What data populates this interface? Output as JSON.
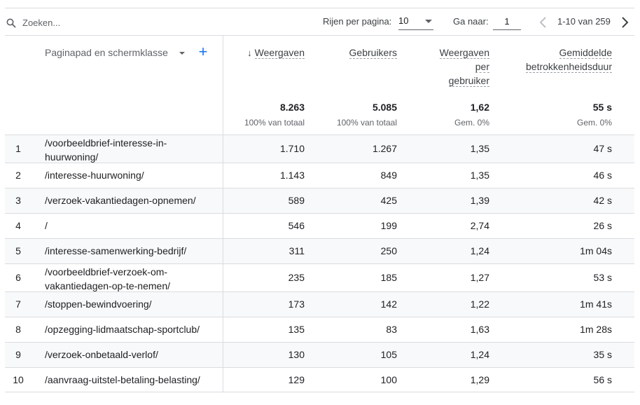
{
  "toolbar": {
    "search_placeholder": "Zoeken...",
    "rows_per_page_label": "Rijen per pagina:",
    "rows_per_page_value": "10",
    "goto_label": "Ga naar:",
    "goto_value": "1",
    "range_text": "1-10 van 259"
  },
  "header": {
    "dimension_label": "Paginapad en schermklasse",
    "columns": [
      {
        "label_lines": [
          "Weergaven"
        ],
        "total": "8.263",
        "total_sub": "100% van totaal",
        "sorted": true
      },
      {
        "label_lines": [
          "Gebruikers"
        ],
        "total": "5.085",
        "total_sub": "100% van totaal",
        "sorted": false
      },
      {
        "label_lines": [
          "Weergaven",
          "per",
          "gebruiker"
        ],
        "total": "1,62",
        "total_sub": "Gem. 0%",
        "sorted": false
      },
      {
        "label_lines": [
          "Gemiddelde",
          "betrokkenheidsduur"
        ],
        "total": "55 s",
        "total_sub": "Gem. 0%",
        "sorted": false
      }
    ]
  },
  "rows": [
    {
      "index": "1",
      "path_lines": [
        "/voorbeeldbrief-interesse-in-",
        "huurwoning/"
      ],
      "views": "1.710",
      "users": "1.267",
      "views_per_user": "1,35",
      "duration": "47 s"
    },
    {
      "index": "2",
      "path_lines": [
        "/interesse-huurwoning/"
      ],
      "views": "1.143",
      "users": "849",
      "views_per_user": "1,35",
      "duration": "46 s"
    },
    {
      "index": "3",
      "path_lines": [
        "/verzoek-vakantiedagen-opnemen/"
      ],
      "views": "589",
      "users": "425",
      "views_per_user": "1,39",
      "duration": "42 s"
    },
    {
      "index": "4",
      "path_lines": [
        "/"
      ],
      "views": "546",
      "users": "199",
      "views_per_user": "2,74",
      "duration": "26 s"
    },
    {
      "index": "5",
      "path_lines": [
        "/interesse-samenwerking-bedrijf/"
      ],
      "views": "311",
      "users": "250",
      "views_per_user": "1,24",
      "duration": "1m 04s"
    },
    {
      "index": "6",
      "path_lines": [
        "/voorbeeldbrief-verzoek-om-",
        "vakantiedagen-op-te-nemen/"
      ],
      "views": "235",
      "users": "185",
      "views_per_user": "1,27",
      "duration": "53 s"
    },
    {
      "index": "7",
      "path_lines": [
        "/stoppen-bewindvoering/"
      ],
      "views": "173",
      "users": "142",
      "views_per_user": "1,22",
      "duration": "1m 41s"
    },
    {
      "index": "8",
      "path_lines": [
        "/opzegging-lidmaatschap-sportclub/"
      ],
      "views": "135",
      "users": "83",
      "views_per_user": "1,63",
      "duration": "1m 28s"
    },
    {
      "index": "9",
      "path_lines": [
        "/verzoek-onbetaald-verlof/"
      ],
      "views": "130",
      "users": "105",
      "views_per_user": "1,24",
      "duration": "35 s"
    },
    {
      "index": "10",
      "path_lines": [
        "/aanvraag-uitstel-betaling-belasting/"
      ],
      "views": "129",
      "users": "100",
      "views_per_user": "1,29",
      "duration": "56 s"
    }
  ]
}
